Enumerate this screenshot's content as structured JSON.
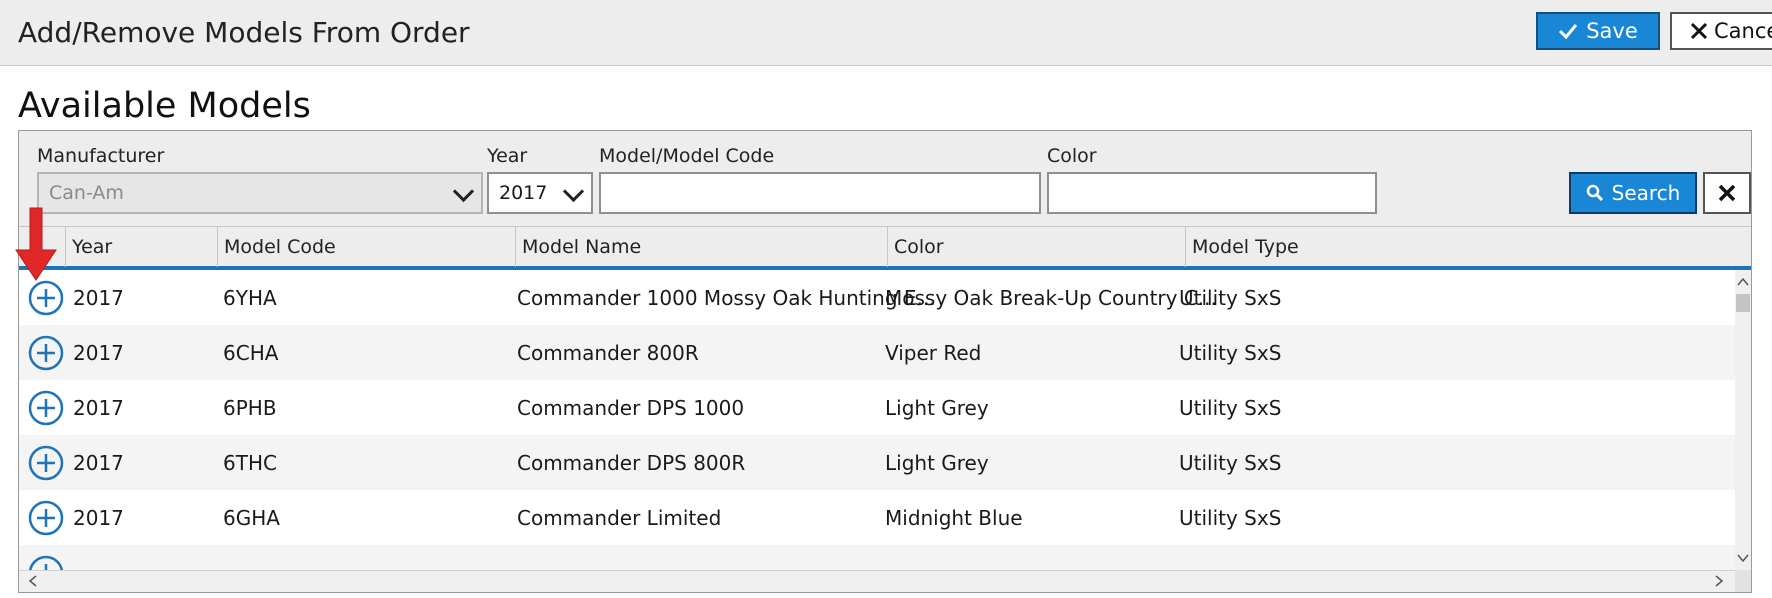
{
  "dialog": {
    "title": "Add/Remove Models From Order",
    "save_label": "Save",
    "cancel_label": "Cancel"
  },
  "section": {
    "title": "Available Models"
  },
  "filters": {
    "manufacturer": {
      "label": "Manufacturer",
      "value": "Can-Am"
    },
    "year": {
      "label": "Year",
      "value": "2017"
    },
    "model_code": {
      "label": "Model/Model Code",
      "value": ""
    },
    "color": {
      "label": "Color",
      "value": ""
    },
    "search_label": "Search"
  },
  "grid": {
    "columns": [
      "Year",
      "Model Code",
      "Model Name",
      "Color",
      "Model Type"
    ],
    "rows": [
      {
        "year": "2017",
        "code": "6YHA",
        "name": "Commander 1000 Mossy Oak Hunting E...",
        "color": "Mossy Oak Break-Up Country C...",
        "type": "Utility SxS"
      },
      {
        "year": "2017",
        "code": "6CHA",
        "name": "Commander 800R",
        "color": "Viper Red",
        "type": "Utility SxS"
      },
      {
        "year": "2017",
        "code": "6PHB",
        "name": "Commander DPS 1000",
        "color": "Light Grey",
        "type": "Utility SxS"
      },
      {
        "year": "2017",
        "code": "6THC",
        "name": "Commander DPS 800R",
        "color": "Light Grey",
        "type": "Utility SxS"
      },
      {
        "year": "2017",
        "code": "6GHA",
        "name": "Commander Limited",
        "color": "Midnight Blue",
        "type": "Utility SxS"
      }
    ]
  },
  "colors": {
    "accent": "#1a87d6",
    "header_rule": "#1f73b7",
    "pointer": "#e02828"
  },
  "icons": {
    "add": "plus-circle-icon",
    "save": "check-icon",
    "cancel": "close-icon",
    "search": "magnifier-icon"
  }
}
